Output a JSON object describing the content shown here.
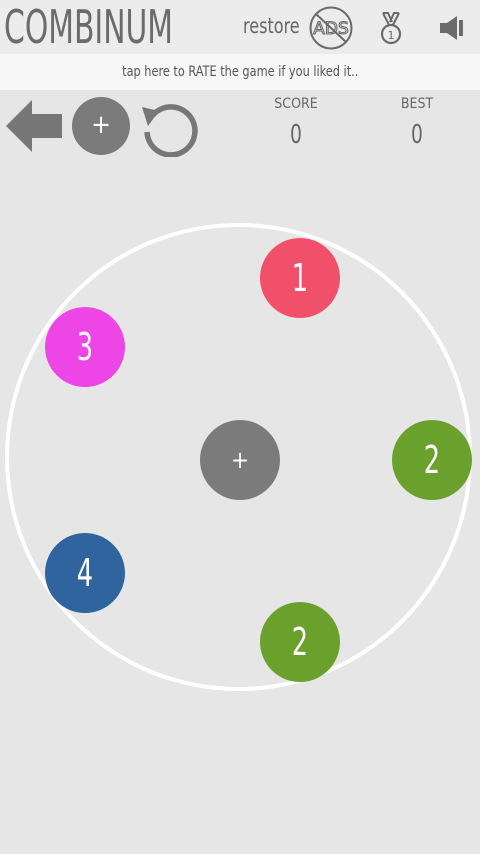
{
  "header": {
    "title": "COMBINUM",
    "restore_label": "restore",
    "ads_icon_text": "ADS",
    "medal_number": "1"
  },
  "rate_banner": {
    "text": "tap here to RATE the game if you liked it.."
  },
  "controls": {
    "plus_label": "+"
  },
  "stats": {
    "score_label": "SCORE",
    "score_value": "0",
    "best_label": "BEST",
    "best_value": "0"
  },
  "board": {
    "center_label": "+",
    "atoms": [
      {
        "value": "1",
        "color": "#f0506a"
      },
      {
        "value": "3",
        "color": "#ee45e6"
      },
      {
        "value": "2",
        "color": "#6aa12c"
      },
      {
        "value": "4",
        "color": "#2f649f"
      },
      {
        "value": "2",
        "color": "#6aa12c"
      }
    ]
  },
  "colors": {
    "background": "#e6e6e6",
    "button_gray": "#7b7b7b",
    "ring": "#ffffff"
  }
}
